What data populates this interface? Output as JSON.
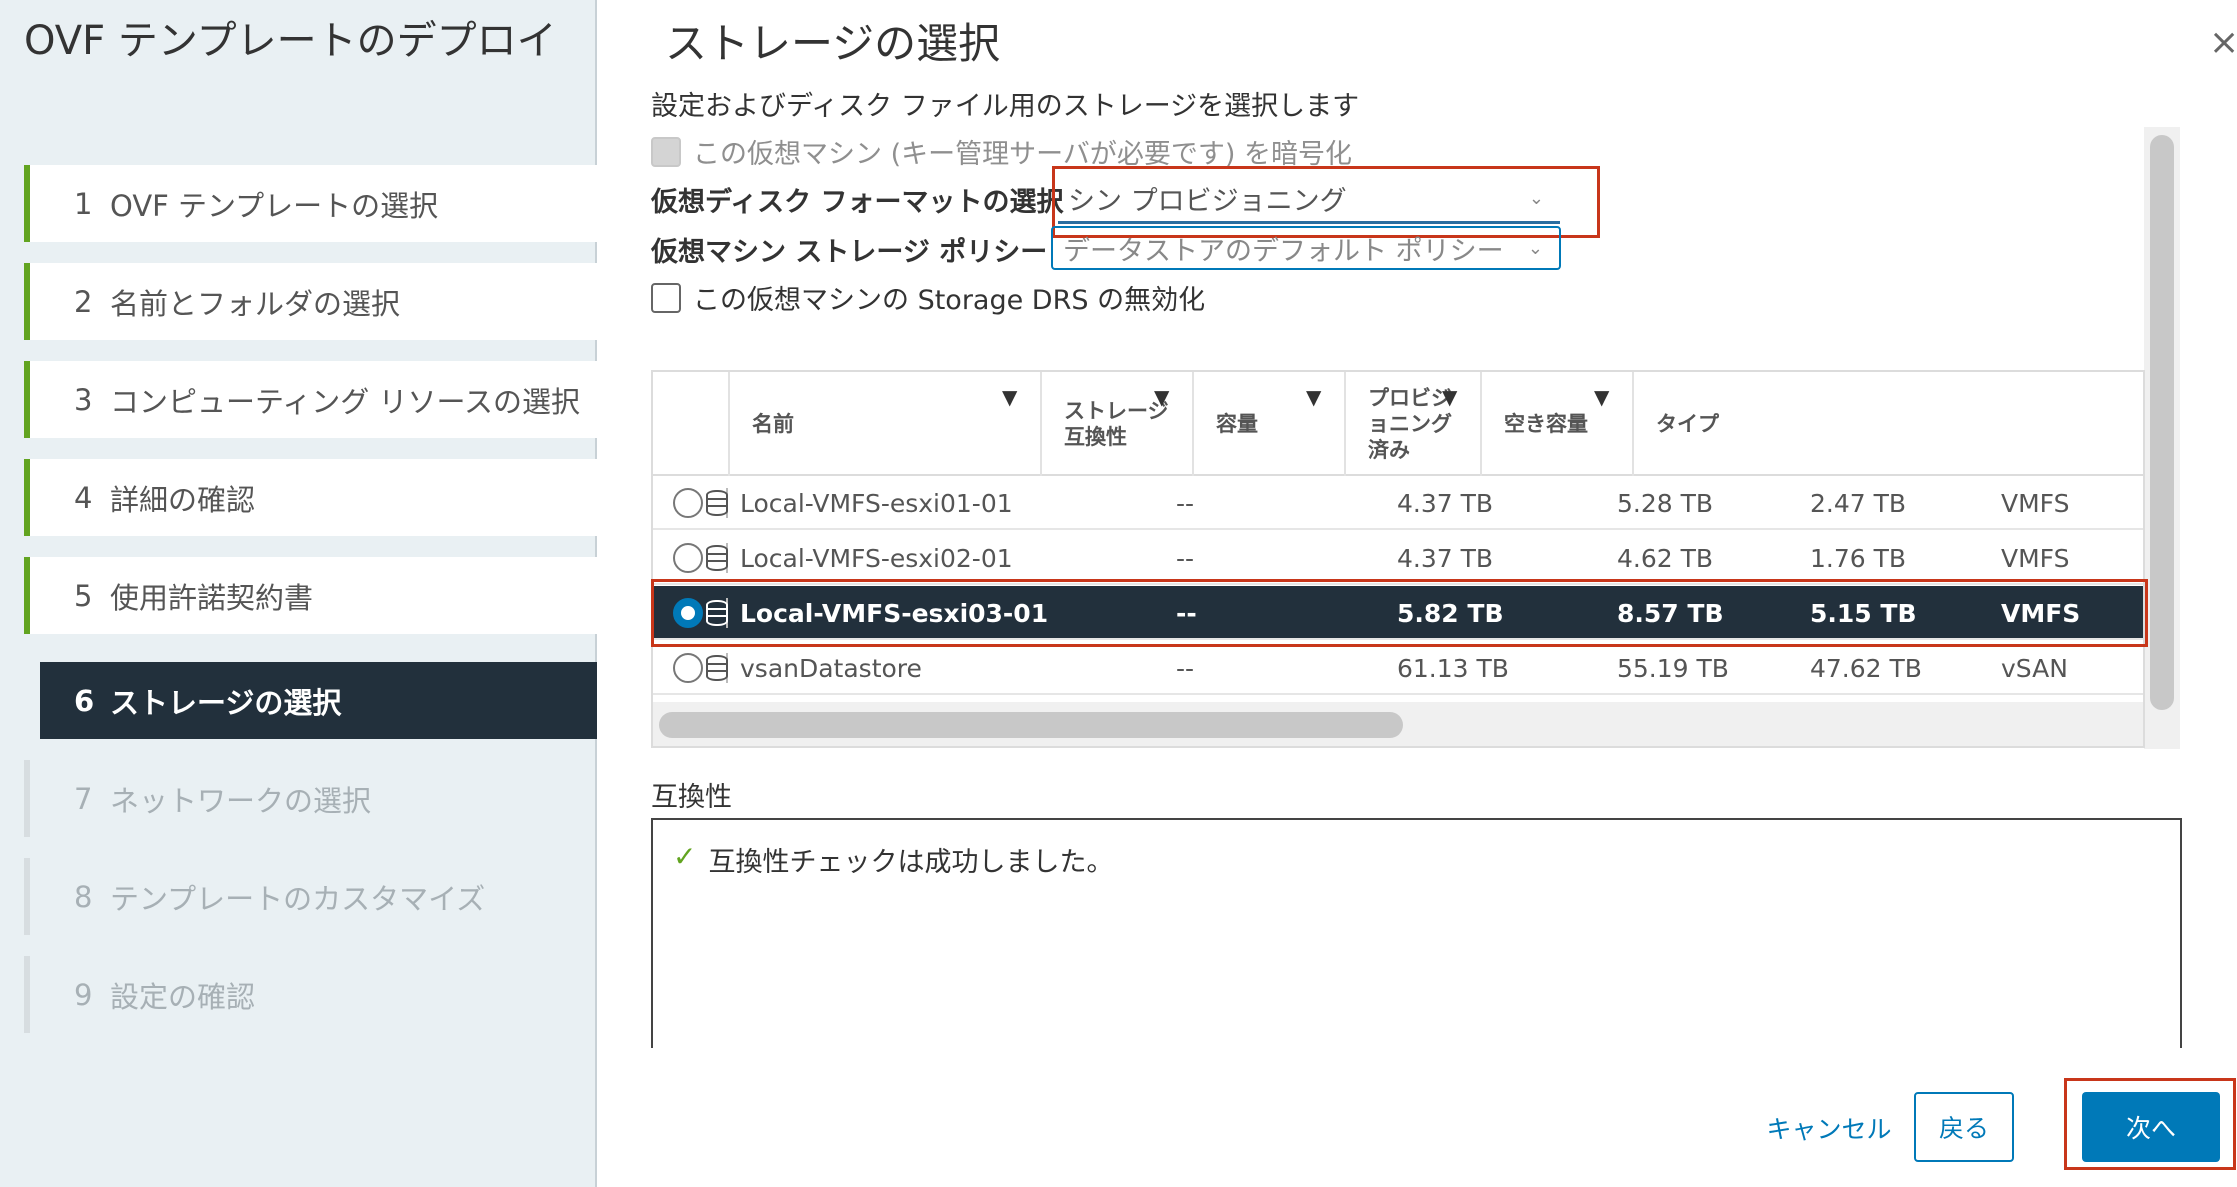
{
  "wizard": {
    "title": "OVF テンプレートのデプロイ",
    "steps": [
      {
        "num": "1",
        "label": "OVF テンプレートの選択"
      },
      {
        "num": "2",
        "label": "名前とフォルダの選択"
      },
      {
        "num": "3",
        "label": "コンピューティング リソースの選択"
      },
      {
        "num": "4",
        "label": "詳細の確認"
      },
      {
        "num": "5",
        "label": "使用許諾契約書"
      },
      {
        "num": "6",
        "label": "ストレージの選択"
      },
      {
        "num": "7",
        "label": "ネットワークの選択"
      },
      {
        "num": "8",
        "label": "テンプレートのカスタマイズ"
      },
      {
        "num": "9",
        "label": "設定の確認"
      }
    ],
    "active_step": "6"
  },
  "page": {
    "title": "ストレージの選択",
    "subtitle": "設定およびディスク ファイル用のストレージを選択します",
    "close_glyph": "×"
  },
  "options": {
    "encrypt_label": "この仮想マシン (キー管理サーバが必要です) を暗号化",
    "disk_format_label": "仮想ディスク フォーマットの選択",
    "disk_format_value": "シン プロビジョニング",
    "policy_label": "仮想マシン ストレージ ポリシー",
    "policy_value": "データストアのデフォルト ポリシー",
    "sdrs_label": "この仮想マシンの Storage DRS の無効化",
    "chevron": "⌄"
  },
  "table": {
    "columns": [
      "名前",
      "ストレージ\n互換性",
      "容量",
      "プロビジ\nョニング\n済み",
      "空き容量",
      "タイプ"
    ],
    "filter_glyph": "▼",
    "rows": [
      {
        "name": "Local-VMFS-esxi01-01",
        "compat": "--",
        "capacity": "4.37 TB",
        "provisioned": "5.28 TB",
        "free": "2.47 TB",
        "type": "VMFS"
      },
      {
        "name": "Local-VMFS-esxi02-01",
        "compat": "--",
        "capacity": "4.37 TB",
        "provisioned": "4.62 TB",
        "free": "1.76 TB",
        "type": "VMFS"
      },
      {
        "name": "Local-VMFS-esxi03-01",
        "compat": "--",
        "capacity": "5.82 TB",
        "provisioned": "8.57 TB",
        "free": "5.15 TB",
        "type": "VMFS"
      },
      {
        "name": "vsanDatastore",
        "compat": "--",
        "capacity": "61.13 TB",
        "provisioned": "55.19 TB",
        "free": "47.62 TB",
        "type": "vSAN"
      }
    ],
    "selected_index": 2
  },
  "compatibility": {
    "label": "互換性",
    "message": "互換性チェックは成功しました。",
    "check_glyph": "✓"
  },
  "footer": {
    "cancel": "キャンセル",
    "back": "戻る",
    "next": "次へ"
  },
  "colors": {
    "accent": "#0079b8",
    "highlight": "#c8361a",
    "selected_row": "#22303c",
    "done_step": "#62a420"
  }
}
